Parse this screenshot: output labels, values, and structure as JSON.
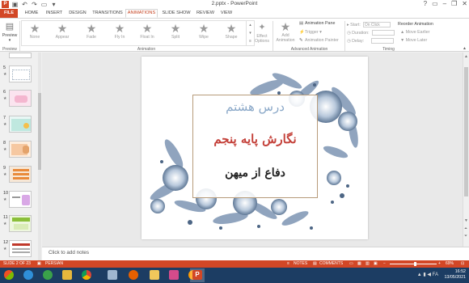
{
  "window": {
    "title": "2.pptx - PowerPoint",
    "help_icon": "help-icon",
    "controls": [
      "–",
      "❐",
      "✕"
    ]
  },
  "tabs": [
    {
      "label": "FILE"
    },
    {
      "label": "HOME"
    },
    {
      "label": "INSERT"
    },
    {
      "label": "DESIGN"
    },
    {
      "label": "TRANSITIONS"
    },
    {
      "label": "ANIMATIONS"
    },
    {
      "label": "SLIDE SHOW"
    },
    {
      "label": "REVIEW"
    },
    {
      "label": "VIEW"
    }
  ],
  "active_tab": "ANIMATIONS",
  "ribbon": {
    "preview": {
      "label": "Preview",
      "group": "Preview"
    },
    "effects": [
      {
        "label": "None",
        "icon": "star-icon"
      },
      {
        "label": "Appear",
        "icon": "star-icon"
      },
      {
        "label": "Fade",
        "icon": "star-icon"
      },
      {
        "label": "Fly In",
        "icon": "star-icon"
      },
      {
        "label": "Float In",
        "icon": "star-icon"
      },
      {
        "label": "Split",
        "icon": "star-icon"
      },
      {
        "label": "Wipe",
        "icon": "star-icon"
      },
      {
        "label": "Shape",
        "icon": "star-icon"
      }
    ],
    "effect_options": {
      "line1": "Effect",
      "line2": "Options"
    },
    "animation_group": "Animation",
    "add_animation": {
      "line1": "Add",
      "line2": "Animation"
    },
    "advanced": {
      "items": [
        "Animation Pane",
        "Trigger",
        "Animation Painter"
      ],
      "group": "Advanced Animation"
    },
    "timing": {
      "start_label": "Start:",
      "start_value": "On Click",
      "duration_label": "Duration:",
      "delay_label": "Delay:",
      "reorder_title": "Reorder Animation",
      "move_earlier": "Move Earlier",
      "move_later": "Move Later",
      "group": "Timing"
    }
  },
  "thumbnails": [
    {
      "num": "5"
    },
    {
      "num": "6"
    },
    {
      "num": "7"
    },
    {
      "num": "8"
    },
    {
      "num": "9"
    },
    {
      "num": "10"
    },
    {
      "num": "11"
    },
    {
      "num": "12"
    }
  ],
  "slide": {
    "line1": "درس هشتم",
    "line2": "نگارش پایه پنجم",
    "line3": "دفاع از میهن",
    "colors": {
      "line1": "#8aa8c8",
      "line2": "#c4413a",
      "line3": "#222222",
      "frame": "#b79b7a"
    }
  },
  "notes_placeholder": "Click to add notes",
  "status": {
    "slide_of": "SLIDE 2 OF 23",
    "language": "PERSIAN",
    "notes": "NOTES",
    "comments": "COMMENTS",
    "zoom": "69%"
  },
  "taskbar": {
    "time": "16:52",
    "date": "13/05/2021",
    "lang": "FA",
    "apps": [
      "windows-start",
      "ie-icon",
      "explorer-icon",
      "chrome-icon",
      "monitor-icon",
      "firefox-icon",
      "folder-icon",
      "media-icon",
      "play-icon",
      "powerpoint-icon"
    ]
  },
  "accent_color": "#d24726"
}
